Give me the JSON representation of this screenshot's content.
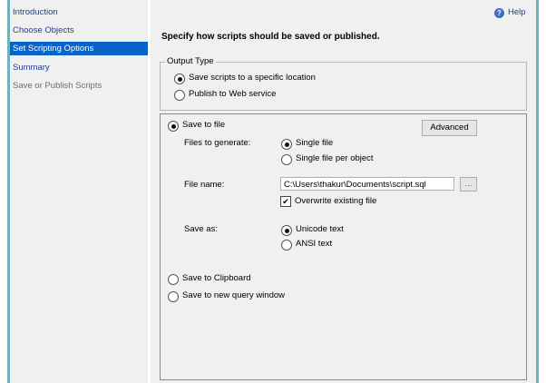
{
  "nav": {
    "items": [
      {
        "label": "Introduction",
        "state": "normal"
      },
      {
        "label": "Choose Objects",
        "state": "normal"
      },
      {
        "label": "Set Scripting Options",
        "state": "selected"
      },
      {
        "label": "Summary",
        "state": "normal"
      },
      {
        "label": "Save or Publish Scripts",
        "state": "disabled"
      }
    ]
  },
  "header": {
    "help_label": "Help",
    "title": "Specify how scripts should be saved or published."
  },
  "output_type": {
    "legend": "Output Type",
    "options": [
      {
        "label": "Save scripts to a specific location",
        "checked": true
      },
      {
        "label": "Publish to Web service",
        "checked": false
      }
    ]
  },
  "save": {
    "save_to_file_label": "Save to file",
    "advanced_label": "Advanced",
    "files_to_generate_label": "Files to generate:",
    "files_options": [
      {
        "label": "Single file",
        "checked": true
      },
      {
        "label": "Single file per object",
        "checked": false
      }
    ],
    "file_name_label": "File name:",
    "file_name_value": "C:\\Users\\thakur\\Documents\\script.sql",
    "browse_label": "...",
    "overwrite_label": "Overwrite existing file",
    "save_as_label": "Save as:",
    "save_as_options": [
      {
        "label": "Unicode text",
        "checked": true
      },
      {
        "label": "ANSI text",
        "checked": false
      }
    ],
    "clipboard_label": "Save to Clipboard",
    "query_window_label": "Save to new query window"
  }
}
